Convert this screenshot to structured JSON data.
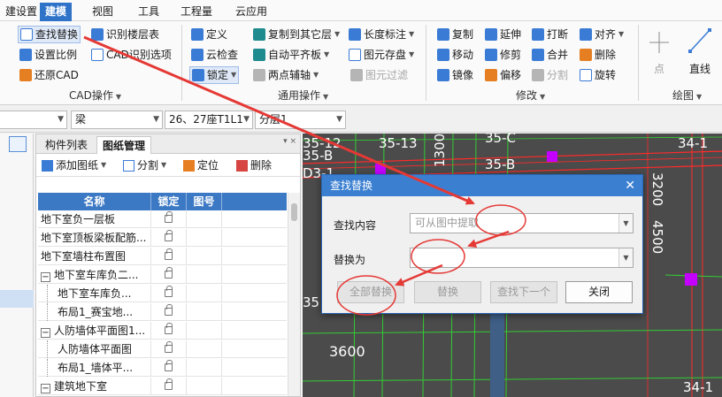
{
  "menu": {
    "items": [
      {
        "label": "建设置",
        "active": false
      },
      {
        "label": "建模",
        "active": true
      },
      {
        "label": "视图",
        "active": false
      },
      {
        "label": "工具",
        "active": false
      },
      {
        "label": "工程量",
        "active": false
      },
      {
        "label": "云应用",
        "active": false
      }
    ]
  },
  "ribbon": {
    "cad": {
      "find_replace": "查找替换",
      "identify_floor_table": "识别楼层表",
      "set_scale": "设置比例",
      "cad_identify_options": "CAD识别选项",
      "restore_cad": "还原CAD",
      "group_label": "CAD操作"
    },
    "general": {
      "define": "定义",
      "copy_to_other_layer": "复制到其它层",
      "length_dimension": "长度标注",
      "cloud_check": "云检查",
      "auto_flat_board": "自动平齐板",
      "element_save": "图元存盘",
      "lock": "锁定",
      "two_point_axis": "两点辅轴",
      "element_filter": "图元过滤",
      "group_label": "通用操作"
    },
    "modify": {
      "copy": "复制",
      "extend": "延伸",
      "break": "打断",
      "align": "对齐",
      "move": "移动",
      "trim": "修剪",
      "merge": "合并",
      "delete": "删除",
      "mirror": "镜像",
      "offset": "偏移",
      "split": "分割",
      "rotate": "旋转",
      "group_label": "修改"
    },
    "draw": {
      "point": "点",
      "line": "直线",
      "group_label": "绘图"
    }
  },
  "selectors": {
    "combo_blank": "",
    "element_type": "梁",
    "drawing": "26、27座T1L1",
    "layer": "分层1"
  },
  "panel": {
    "tabs": [
      "构件列表",
      "图纸管理"
    ],
    "tools": {
      "add_drawing": "添加图纸",
      "split": "分割",
      "locate": "定位",
      "delete": "删除"
    },
    "columns": [
      "名称",
      "锁定",
      "图号"
    ],
    "rows": [
      {
        "name": "地下室负一层板",
        "level": 0,
        "toggle": ""
      },
      {
        "name": "地下室顶板梁板配筋...",
        "level": 0,
        "toggle": ""
      },
      {
        "name": "地下室墙柱布置图",
        "level": 0,
        "toggle": ""
      },
      {
        "name": "地下室车库负二...",
        "level": 0,
        "toggle": "−"
      },
      {
        "name": "地下室车库负...",
        "level": 1,
        "toggle": ""
      },
      {
        "name": "布局1_赛宝地...",
        "level": 1,
        "toggle": ""
      },
      {
        "name": "人防墙体平面图1...",
        "level": 0,
        "toggle": "−"
      },
      {
        "name": "人防墙体平面图",
        "level": 1,
        "toggle": ""
      },
      {
        "name": "布局1_墙体平...",
        "level": 1,
        "toggle": ""
      },
      {
        "name": "建筑地下室",
        "level": 0,
        "toggle": "−"
      }
    ]
  },
  "canvas": {
    "labels": [
      "35-12",
      "35-13",
      "35-C",
      "34-1",
      "35-B",
      "35-B",
      "D3-1",
      "1300",
      "3200",
      "4500",
      "3600",
      "34-1",
      "35"
    ]
  },
  "dialog": {
    "title": "查找替换",
    "find_label": "查找内容",
    "find_placeholder": "可从图中提取",
    "replace_label": "替换为",
    "replace_value": "",
    "btn_replace_all": "全部替换",
    "btn_replace": "替换",
    "btn_find_next": "查找下一个",
    "btn_close": "关闭"
  },
  "colors": {
    "accent": "#2f73c9",
    "annotation": "#e53935",
    "canvas_bg": "#4b4b4b",
    "cad_red": "#ff2a2a",
    "cad_green": "#33cc33",
    "cad_magenta": "#c400ff"
  }
}
